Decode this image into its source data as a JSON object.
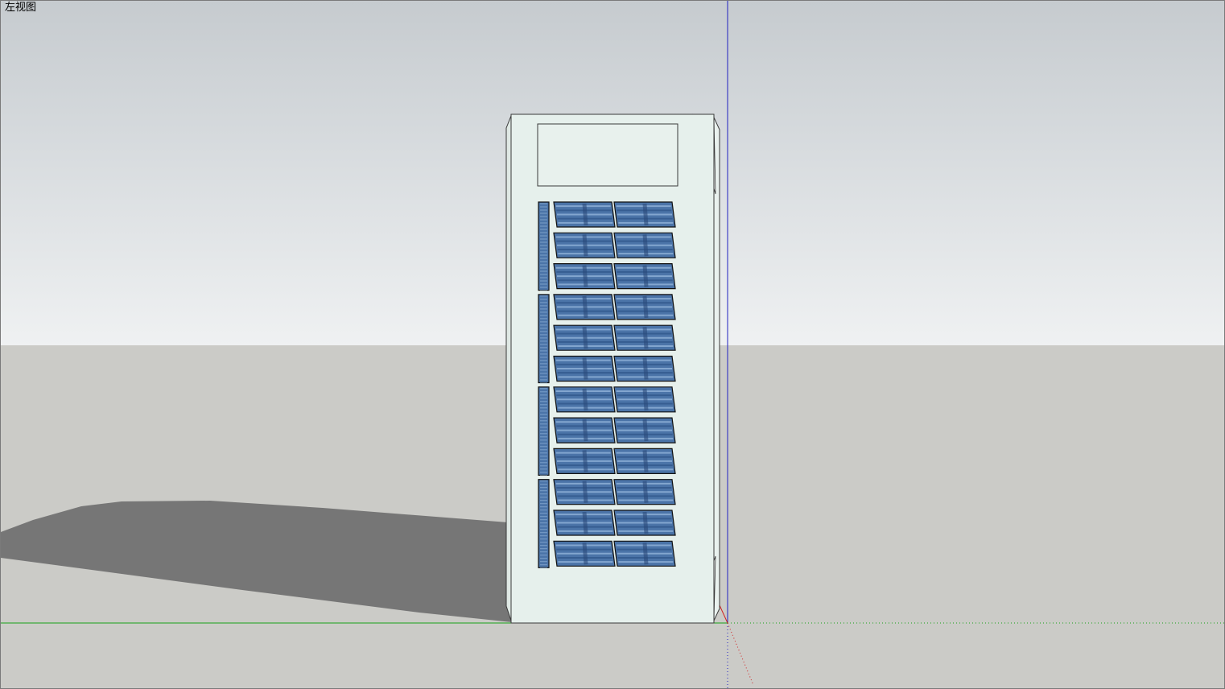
{
  "viewport": {
    "view_label": "左视图",
    "colors": {
      "sky_top": "#c6cbcf",
      "sky_bottom": "#eff1f2",
      "ground": "#cbcbc7",
      "shadow": "#767676",
      "building_face": "#e6f0ec",
      "building_edge": "#3a3a3a",
      "window_glass": "#4b74a8",
      "window_highlight": "#9bbce0",
      "axis_blue": "#2020c0",
      "axis_green": "#1aa01a",
      "axis_red": "#d02020"
    }
  },
  "model": {
    "object": "building-model",
    "window_rows": 12,
    "window_columns": 2,
    "side_strip_groups": 4
  }
}
